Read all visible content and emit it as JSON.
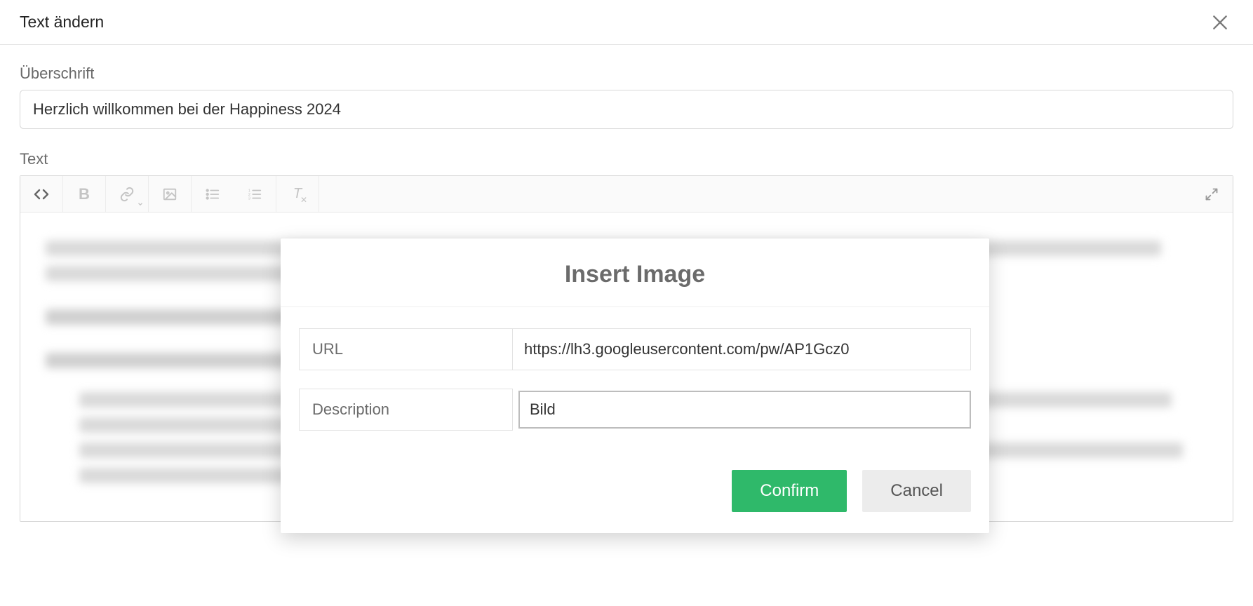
{
  "header": {
    "title": "Text ändern"
  },
  "fields": {
    "heading_label": "Überschrift",
    "heading_value": "Herzlich willkommen bei der Happiness 2024",
    "text_label": "Text"
  },
  "popup": {
    "title": "Insert Image",
    "url_label": "URL",
    "url_value": "https://lh3.googleusercontent.com/pw/AP1Gcz0",
    "description_label": "Description",
    "description_value": "Bild",
    "confirm_label": "Confirm",
    "cancel_label": "Cancel"
  }
}
